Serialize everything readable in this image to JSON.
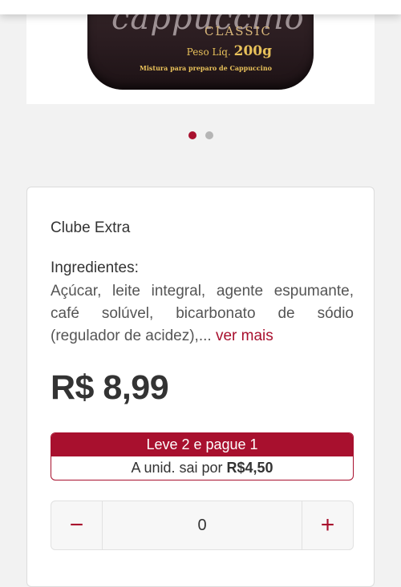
{
  "product_image": {
    "script_text": "cappuccino",
    "classic_text": "CLASSIC",
    "weight_label": "Peso Líq.",
    "weight_value": "200g",
    "mix_text": "Mistura para preparo de Cappuccino"
  },
  "carousel": {
    "total": 2,
    "active": 1
  },
  "brand": "Clube Extra",
  "ingredients": {
    "title": "Ingredientes:",
    "text": "Açúcar, leite integral, agente espumante, café solúvel, bicarbonato de sódio (regulador de acidez),... ",
    "more_link": "ver mais"
  },
  "price": "R$ 8,99",
  "promo": {
    "headline": "Leve 2 e pague 1",
    "unit_prefix": "A unid. sai por",
    "unit_price": "R$4,50"
  },
  "quantity": {
    "minus": "−",
    "value": "0",
    "plus": "+"
  },
  "colors": {
    "accent": "#a8102e",
    "background": "#f2f2f2"
  }
}
